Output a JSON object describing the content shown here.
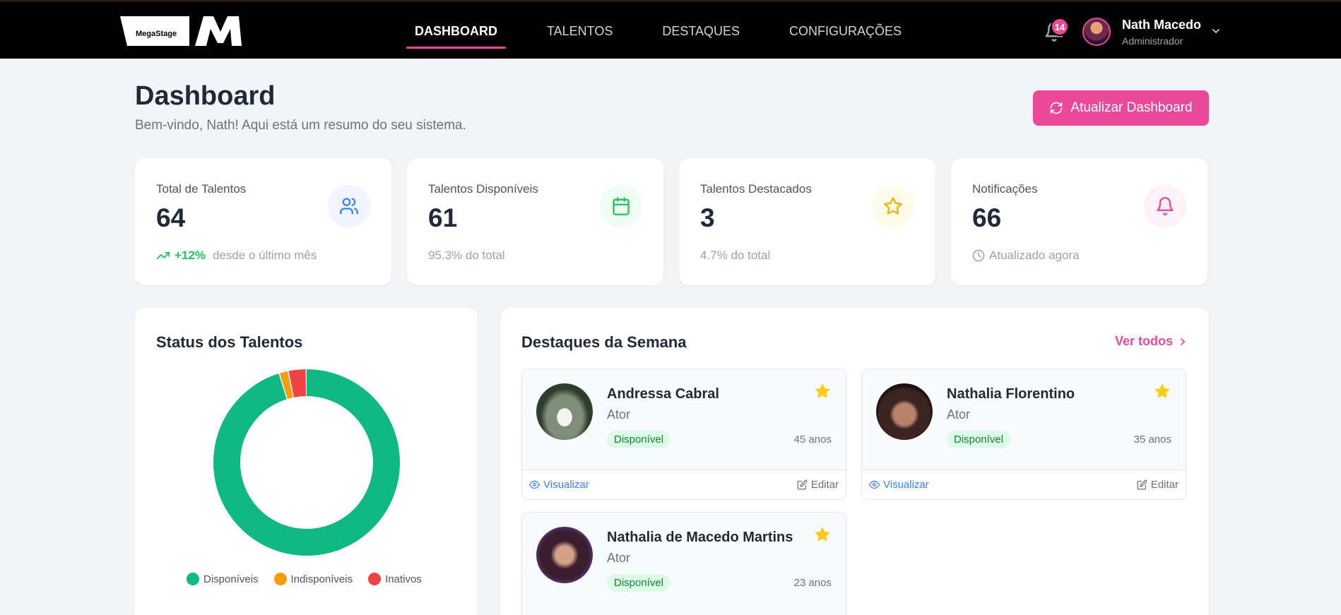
{
  "brand": {
    "logo_text": "MegaStage",
    "accent": "#ec4899"
  },
  "nav": {
    "items": [
      {
        "label": "DASHBOARD",
        "active": true
      },
      {
        "label": "TALENTOS",
        "active": false
      },
      {
        "label": "DESTAQUES",
        "active": false
      },
      {
        "label": "CONFIGURAÇÕES",
        "active": false
      }
    ]
  },
  "topbar": {
    "notif_count": "14",
    "user_name": "Nath Macedo",
    "user_role": "Administrador"
  },
  "header": {
    "title": "Dashboard",
    "subtitle": "Bem-vindo, Nath! Aqui está um resumo do seu sistema.",
    "refresh_label": "Atualizar Dashboard"
  },
  "stats": [
    {
      "label": "Total de Talentos",
      "value": "64",
      "trend": "+12%",
      "foot": "desde o último mês",
      "icon": "users-icon",
      "icon_color": "#3b82f6",
      "icon_bg": "#eff6ff"
    },
    {
      "label": "Talentos Disponíveis",
      "value": "61",
      "foot": "95.3% do total",
      "icon": "calendar-icon",
      "icon_color": "#22c55e",
      "icon_bg": "#f0fdf4"
    },
    {
      "label": "Talentos Destacados",
      "value": "3",
      "foot": "4.7% do total",
      "icon": "star-icon",
      "icon_color": "#eab308",
      "icon_bg": "#fefce8"
    },
    {
      "label": "Notificações",
      "value": "66",
      "foot": "Atualizado agora",
      "icon": "bell-icon",
      "icon_color": "#ec4899",
      "icon_bg": "#fdf2f8"
    }
  ],
  "status": {
    "title": "Status dos Talentos",
    "legend": [
      {
        "label": "Disponíveis",
        "color": "#10b981"
      },
      {
        "label": "Indisponíveis",
        "color": "#f59e0b"
      },
      {
        "label": "Inativos",
        "color": "#ef4444"
      }
    ]
  },
  "chart_data": {
    "type": "pie",
    "title": "Status dos Talentos",
    "categories": [
      "Disponíveis",
      "Indisponíveis",
      "Inativos"
    ],
    "values": [
      61,
      1,
      2
    ],
    "colors": [
      "#10b981",
      "#f59e0b",
      "#ef4444"
    ],
    "legend_position": "bottom"
  },
  "highlights": {
    "title": "Destaques da Semana",
    "see_all": "Ver todos",
    "view_label": "Visualizar",
    "edit_label": "Editar",
    "talents": [
      {
        "name": "Andressa Cabral",
        "role": "Ator",
        "status": "Disponível",
        "age": "45 anos"
      },
      {
        "name": "Nathalia Florentino",
        "role": "Ator",
        "status": "Disponível",
        "age": "35 anos"
      },
      {
        "name": "Nathalia de Macedo Martins",
        "role": "Ator",
        "status": "Disponível",
        "age": "23 anos"
      }
    ]
  }
}
